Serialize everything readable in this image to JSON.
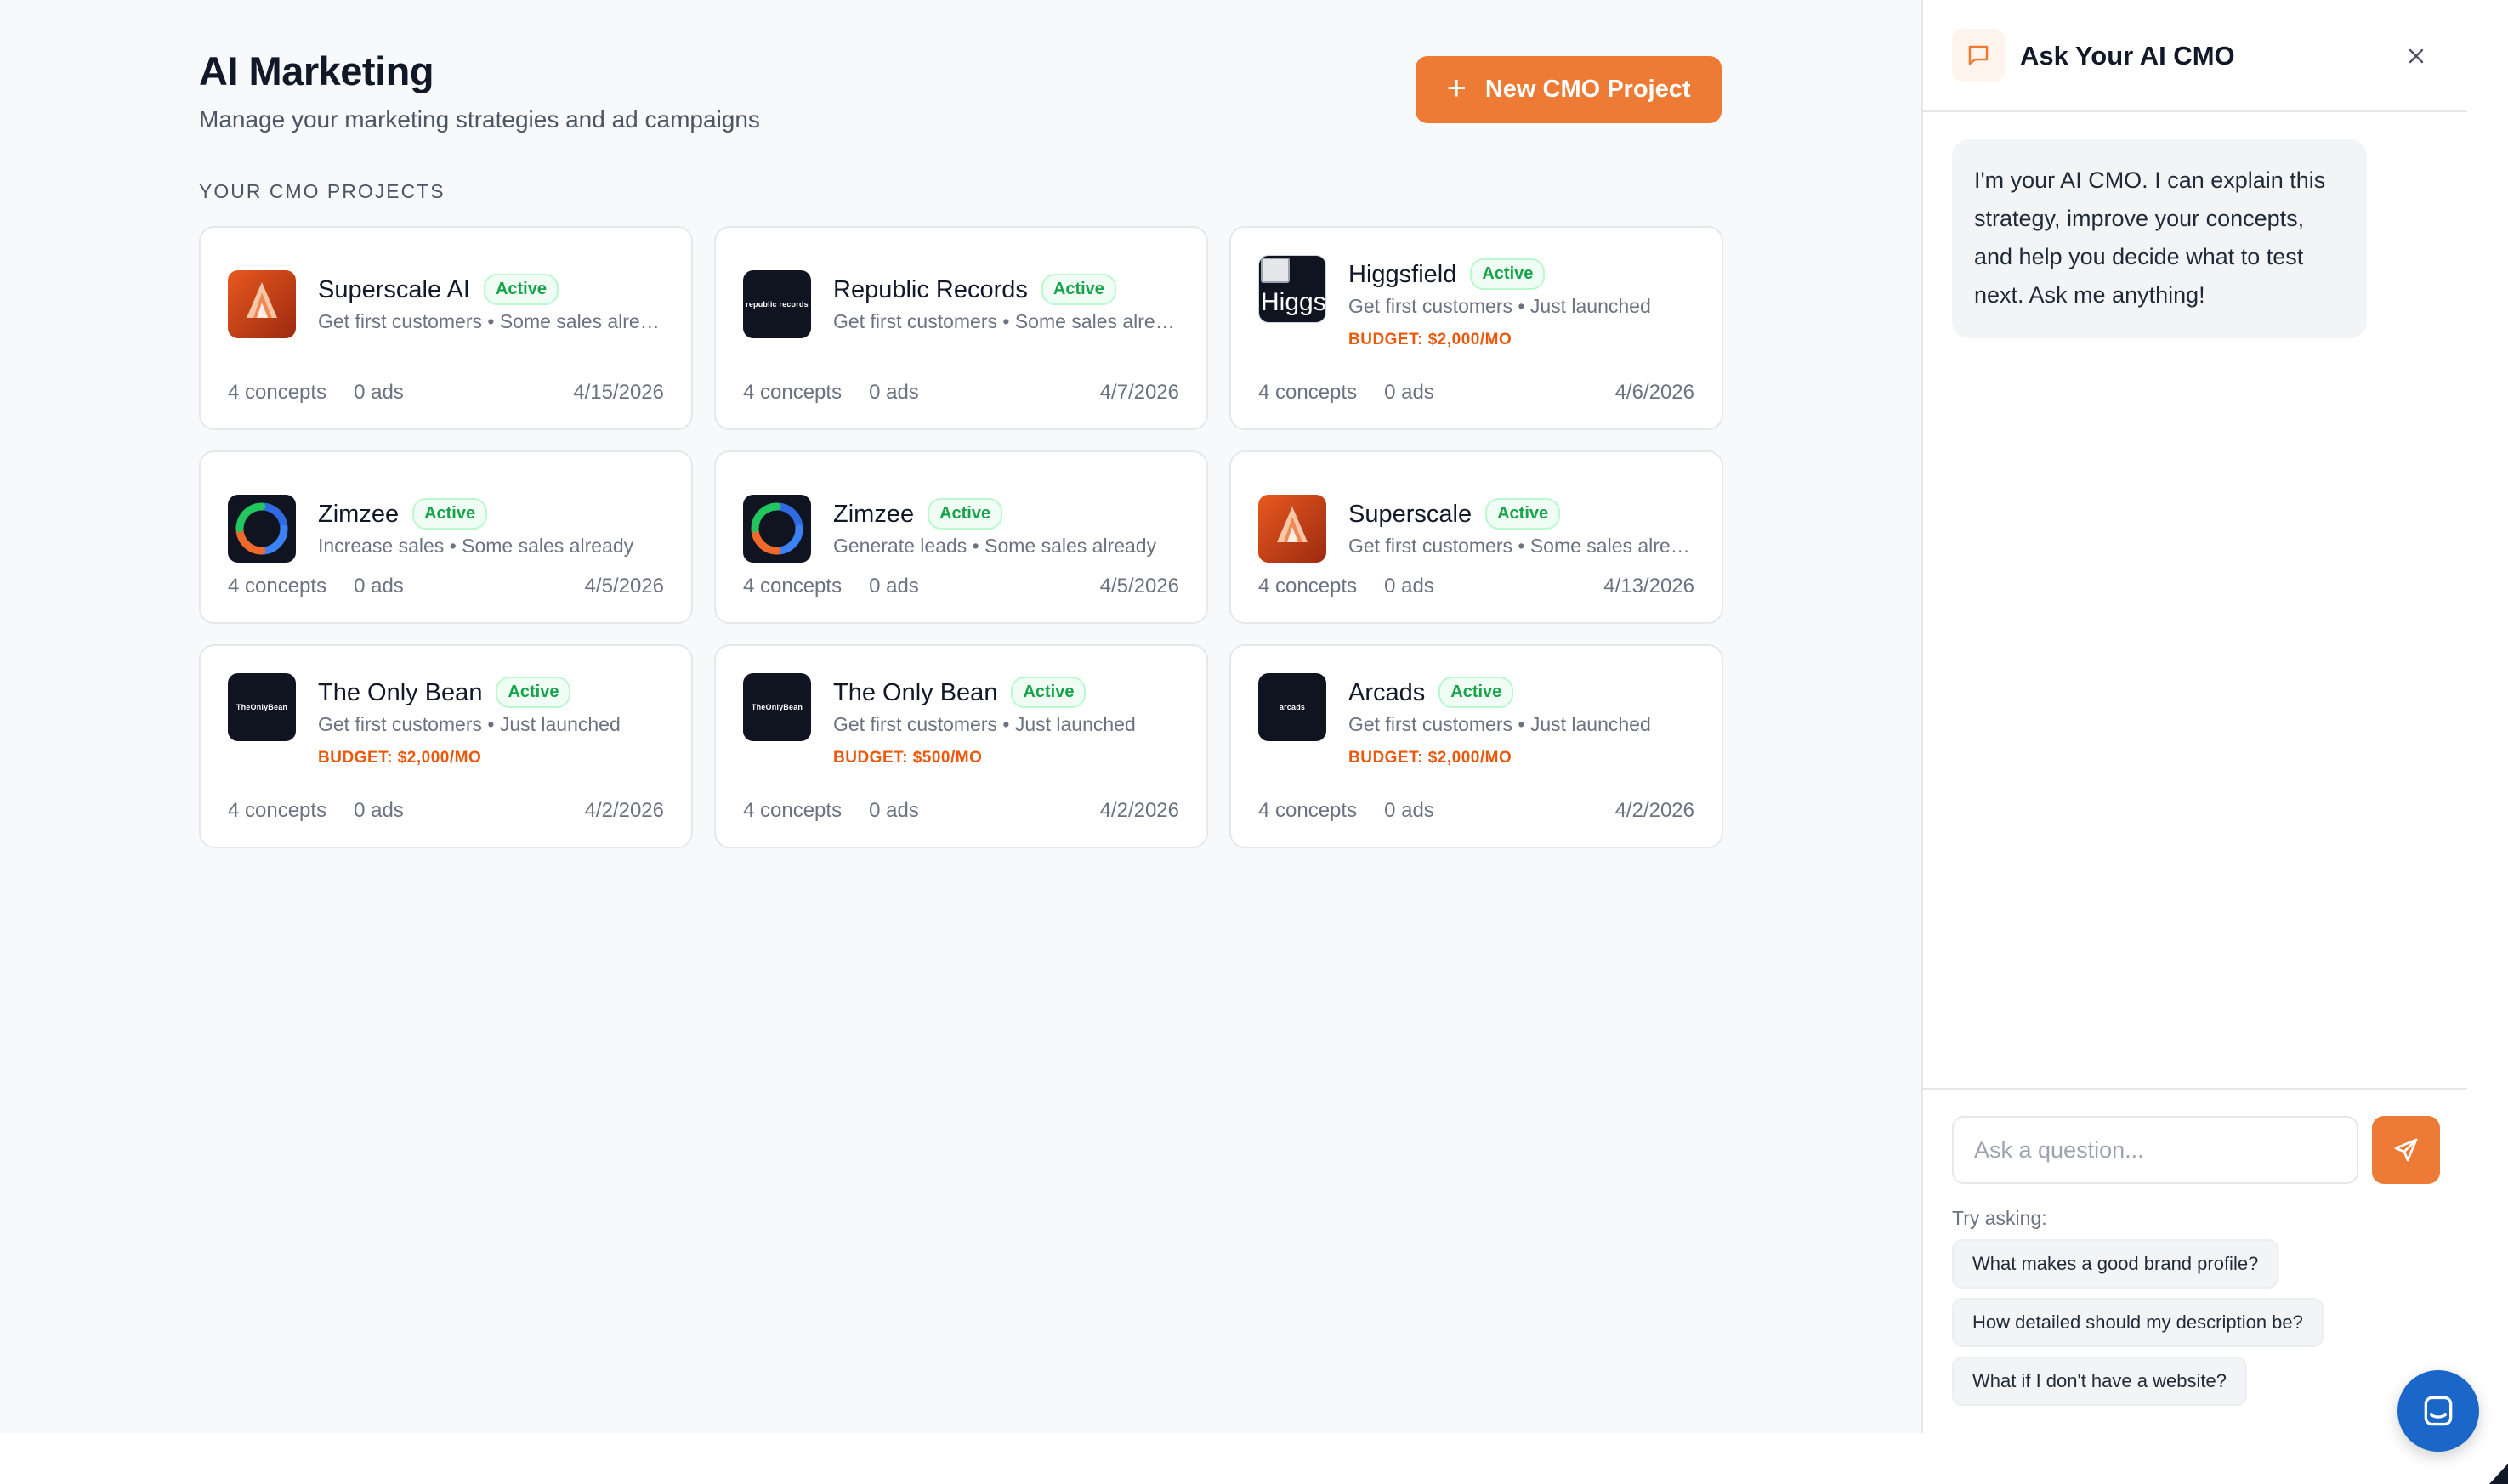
{
  "header": {
    "title": "AI Marketing",
    "subtitle": "Manage your marketing strategies and ad campaigns",
    "new_button_label": "New CMO Project"
  },
  "section_label": "YOUR CMO PROJECTS",
  "projects": [
    {
      "name": "Superscale AI",
      "status": "Active",
      "description": "Get first customers • Some sales already",
      "budget": "",
      "concepts": "4 concepts",
      "ads": "0 ads",
      "date": "4/15/2026",
      "logo": "superscale-flame"
    },
    {
      "name": "Republic Records",
      "status": "Active",
      "description": "Get first customers • Some sales already",
      "budget": "",
      "concepts": "4 concepts",
      "ads": "0 ads",
      "date": "4/7/2026",
      "logo": "republic records"
    },
    {
      "name": "Higgsfield",
      "status": "Active",
      "description": "Get first customers • Just launched",
      "budget": "BUDGET: $2,000/MO",
      "concepts": "4 concepts",
      "ads": "0 ads",
      "date": "4/6/2026",
      "logo": "Higgs"
    },
    {
      "name": "Zimzee",
      "status": "Active",
      "description": "Increase sales • Some sales already",
      "budget": "",
      "concepts": "4 concepts",
      "ads": "0 ads",
      "date": "4/5/2026",
      "logo": "zimzee-ring"
    },
    {
      "name": "Zimzee",
      "status": "Active",
      "description": "Generate leads • Some sales already",
      "budget": "",
      "concepts": "4 concepts",
      "ads": "0 ads",
      "date": "4/5/2026",
      "logo": "zimzee-ring"
    },
    {
      "name": "Superscale",
      "status": "Active",
      "description": "Get first customers • Some sales already",
      "budget": "",
      "concepts": "4 concepts",
      "ads": "0 ads",
      "date": "4/13/2026",
      "logo": "superscale-flame"
    },
    {
      "name": "The Only Bean",
      "status": "Active",
      "description": "Get first customers • Just launched",
      "budget": "BUDGET: $2,000/MO",
      "concepts": "4 concepts",
      "ads": "0 ads",
      "date": "4/2/2026",
      "logo": "TheOnlyBean"
    },
    {
      "name": "The Only Bean",
      "status": "Active",
      "description": "Get first customers • Just launched",
      "budget": "BUDGET: $500/MO",
      "concepts": "4 concepts",
      "ads": "0 ads",
      "date": "4/2/2026",
      "logo": "TheOnlyBean"
    },
    {
      "name": "Arcads",
      "status": "Active",
      "description": "Get first customers • Just launched",
      "budget": "BUDGET: $2,000/MO",
      "concepts": "4 concepts",
      "ads": "0 ads",
      "date": "4/2/2026",
      "logo": "arcads"
    }
  ],
  "chat": {
    "title": "Ask Your AI CMO",
    "welcome_message": "I'm your AI CMO. I can explain this strategy, improve your concepts, and help you decide what to test next. Ask me anything!",
    "input_placeholder": "Ask a question...",
    "try_label": "Try asking:",
    "suggestions": [
      "What makes a good brand profile?",
      "How detailed should my description be?",
      "What if I don't have a website?"
    ]
  },
  "colors": {
    "accent": "#ed7b35",
    "active_green": "#16a34a",
    "budget_orange": "#ea580c",
    "messenger_blue": "#1b66c9"
  },
  "icons": {
    "new_button": "plus-icon",
    "chat_header": "chat-bubble-icon",
    "close": "close-icon",
    "send": "send-icon",
    "messenger": "messenger-icon"
  }
}
